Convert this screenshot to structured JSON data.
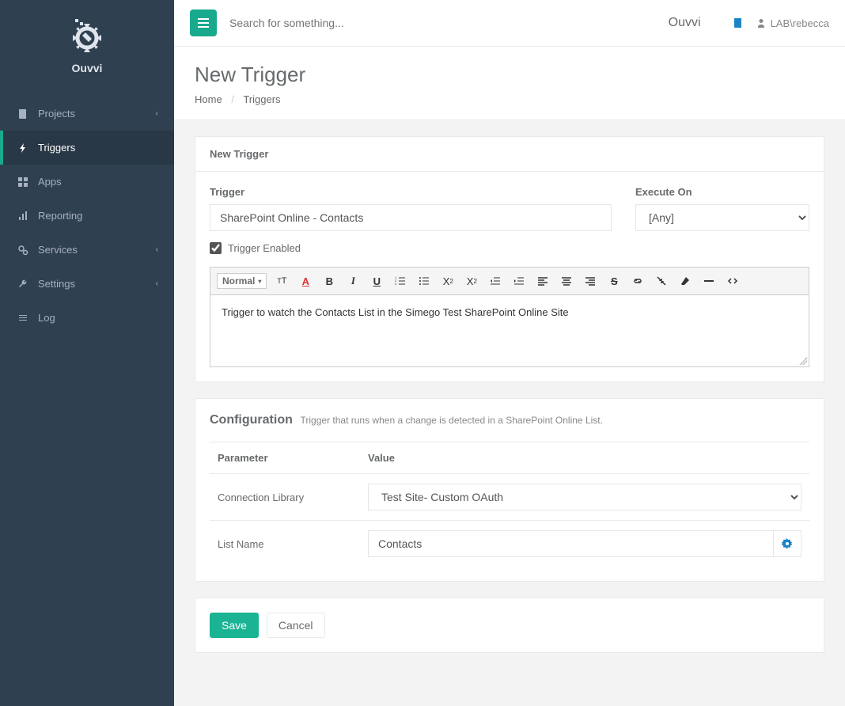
{
  "app": {
    "name": "Ouvvi",
    "brand": "Ouvvi"
  },
  "topbar": {
    "search_placeholder": "Search for something...",
    "user": "LAB\\rebecca"
  },
  "sidebar": {
    "items": [
      {
        "label": "Projects",
        "hasArrow": true
      },
      {
        "label": "Triggers",
        "hasArrow": false
      },
      {
        "label": "Apps",
        "hasArrow": false
      },
      {
        "label": "Reporting",
        "hasArrow": false
      },
      {
        "label": "Services",
        "hasArrow": true
      },
      {
        "label": "Settings",
        "hasArrow": true
      },
      {
        "label": "Log",
        "hasArrow": false
      }
    ]
  },
  "page": {
    "title": "New Trigger",
    "breadcrumb": {
      "home": "Home",
      "current": "Triggers"
    }
  },
  "panel1": {
    "title": "New Trigger",
    "trigger_label": "Trigger",
    "trigger_value": "SharePoint Online - Contacts",
    "execute_label": "Execute On",
    "execute_value": "[Any]",
    "enabled_label": "Trigger Enabled",
    "enabled_checked": true,
    "editor": {
      "format": "Normal",
      "text": "Trigger to watch the Contacts List in the Simego Test SharePoint Online Site"
    }
  },
  "panel2": {
    "title": "Configuration",
    "desc": "Trigger that runs when a change is detected in a SharePoint Online List.",
    "headers": {
      "param": "Parameter",
      "value": "Value"
    },
    "rows": [
      {
        "param": "Connection Library",
        "value": "Test Site- Custom OAuth",
        "type": "select"
      },
      {
        "param": "List Name",
        "value": "Contacts",
        "type": "text"
      }
    ]
  },
  "actions": {
    "save": "Save",
    "cancel": "Cancel"
  }
}
